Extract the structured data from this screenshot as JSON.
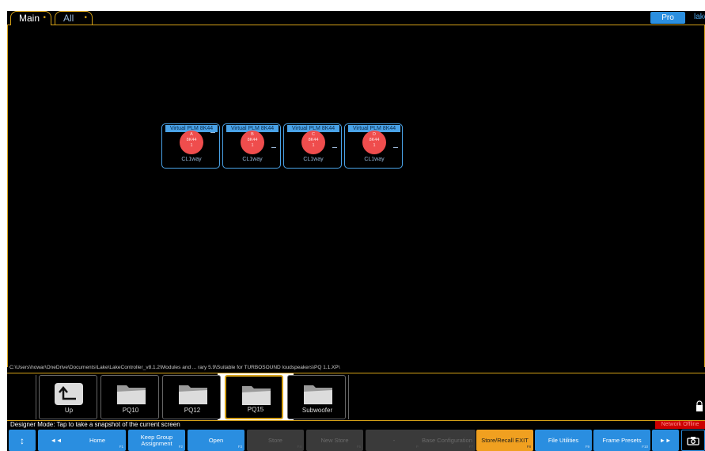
{
  "tabs": [
    {
      "label": "Main",
      "marker": "•"
    },
    {
      "label": "All",
      "marker": "•"
    }
  ],
  "header": {
    "pro_label": "Pro",
    "logo_text": "lake"
  },
  "modules": [
    {
      "title": "Virtual PLM 8K44",
      "letter": "A",
      "model": "8K44",
      "num": "1",
      "label": "CL1way"
    },
    {
      "title": "Virtual PLM 8K44",
      "letter": "B",
      "model": "8K44",
      "num": "1",
      "label": "CL1way"
    },
    {
      "title": "Virtual PLM 8K44",
      "letter": "C",
      "model": "8K44",
      "num": "1",
      "label": "CL1way"
    },
    {
      "title": "Virtual PLM 8K44",
      "letter": "D",
      "model": "8K44",
      "num": "1",
      "label": "CL1way"
    }
  ],
  "path": "C:\\Users\\howar\\OneDrive\\Documents\\Lake\\LakeController_v8.1.2\\Modules and ... rary 5.9\\Suitable for TURBOSOUND loudspeakers\\PQ 1.1.XP\\",
  "folders": [
    {
      "label": "Up",
      "icon": "up-arrow-icon"
    },
    {
      "label": "PQ10",
      "icon": "folder-icon"
    },
    {
      "label": "PQ12",
      "icon": "folder-icon"
    },
    {
      "label": "PQ15",
      "icon": "folder-icon",
      "selected": true
    },
    {
      "label": "Subwoofer",
      "icon": "folder-icon"
    }
  ],
  "status": {
    "message": "Designer Mode: Tap to take a snapshot of the current screen",
    "network": "Network Offline"
  },
  "fkeys": {
    "updown": "↕",
    "rewind": "◄◄",
    "home": "Home",
    "home_f": "F1",
    "keepgroup": "Keep Group Assignment",
    "keepgroup_f": "F2",
    "open": "Open",
    "open_f": "F3",
    "store": "Store",
    "store_f": "F4",
    "newstore": "New Store",
    "newstore_f": "F5",
    "dash": "-",
    "dash_f": "F6",
    "baseconfig": "Base Configuration",
    "baseconfig_f": "F7",
    "storerecall": "Store/Recall EXIT",
    "storerecall_f": "F8",
    "fileutil": "File Utilities",
    "fileutil_f": "F9",
    "framepresets": "Frame Presets",
    "framepresets_f": "F10",
    "forward": "►►",
    "camera": "camera-icon"
  },
  "colors": {
    "accent": "#d4a017",
    "button": "#2a8ee0",
    "active": "#f0a020",
    "module_red": "#ef4d4d",
    "network_red": "#cc0000"
  }
}
